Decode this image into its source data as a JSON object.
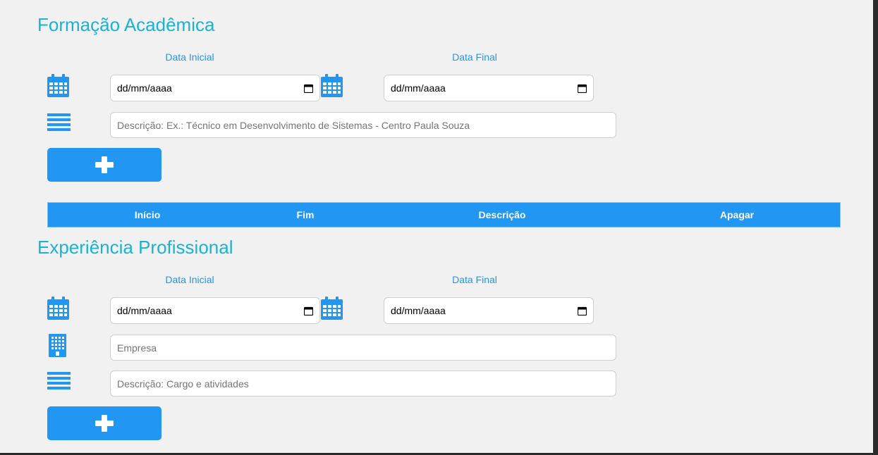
{
  "formacao": {
    "title": "Formação Acadêmica",
    "data_inicial_label": "Data Inicial",
    "data_final_label": "Data Final",
    "data_inicial_value": "dd/mm/aaaa",
    "data_final_value": "dd/mm/aaaa",
    "descricao_placeholder": "Descrição: Ex.: Técnico em Desenvolvimento de Sistemas - Centro Paula Souza",
    "add_button_icon": "plus-icon",
    "table_headers": [
      "Início",
      "Fim",
      "Descrição",
      "Apagar"
    ]
  },
  "experiencia": {
    "title": "Experiência Profissional",
    "data_inicial_label": "Data Inicial",
    "data_final_label": "Data Final",
    "data_inicial_value": "dd/mm/aaaa",
    "data_final_value": "dd/mm/aaaa",
    "empresa_placeholder": "Empresa",
    "descricao_placeholder": "Descrição: Cargo e atividades",
    "add_button_icon": "plus-icon"
  },
  "icons": {
    "date": "calendar-icon",
    "description": "list-lines-icon",
    "company": "building-icon",
    "date_picker": "calendar-picker-icon"
  },
  "colors": {
    "accent": "#2196f3",
    "title": "#19b3d6",
    "background": "#f1f1f1"
  }
}
